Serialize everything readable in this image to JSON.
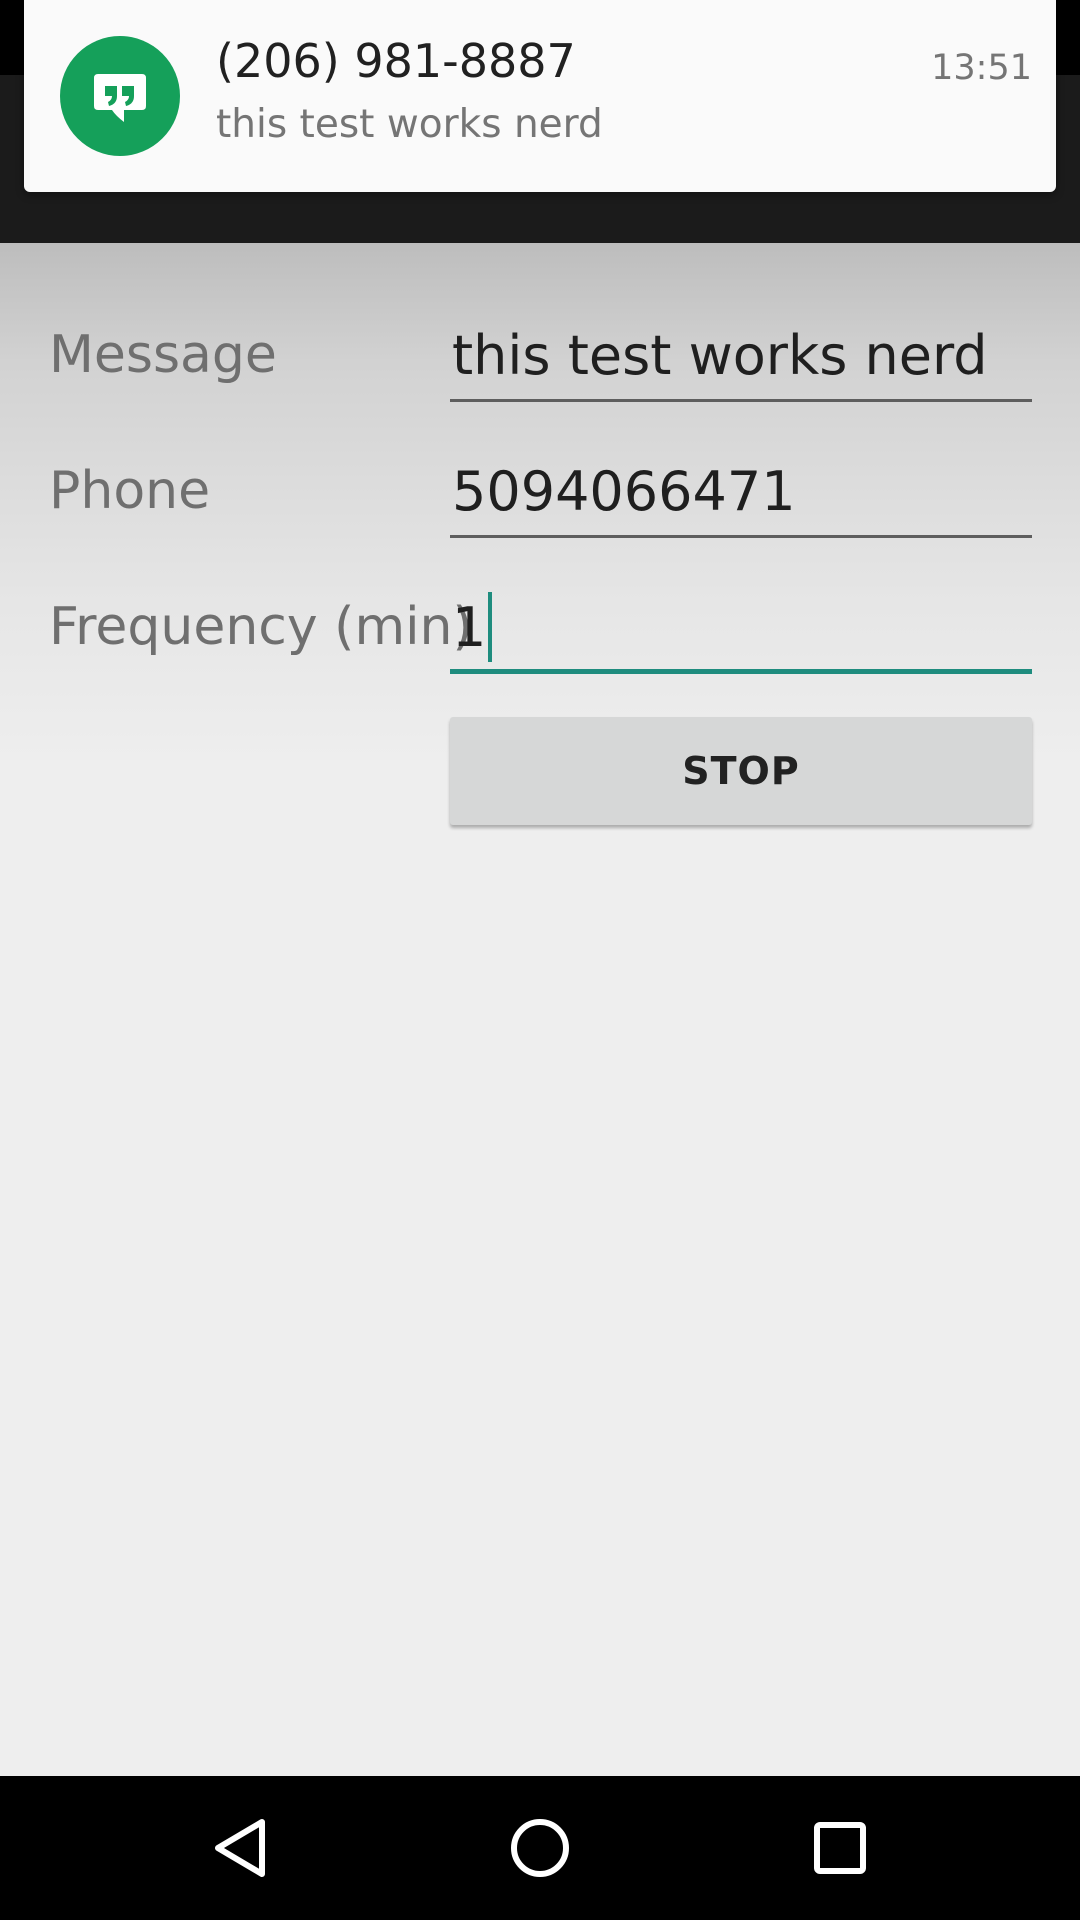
{
  "notification": {
    "title": "(206) 981-8887",
    "text": "this test works nerd",
    "time": "13:51",
    "app_icon": "hangouts-quote-icon",
    "icon_color": "#15a05a"
  },
  "form": {
    "message_label": "Message",
    "message_value": "this test works nerd",
    "phone_label": "Phone",
    "phone_value": "5094066471",
    "frequency_label": "Frequency (min)",
    "frequency_value": "1",
    "stop_label": "STOP"
  },
  "colors": {
    "accent": "#1e8c7e"
  },
  "nav": {
    "back_icon": "back-triangle-icon",
    "home_icon": "home-circle-icon",
    "recents_icon": "recents-square-icon"
  }
}
